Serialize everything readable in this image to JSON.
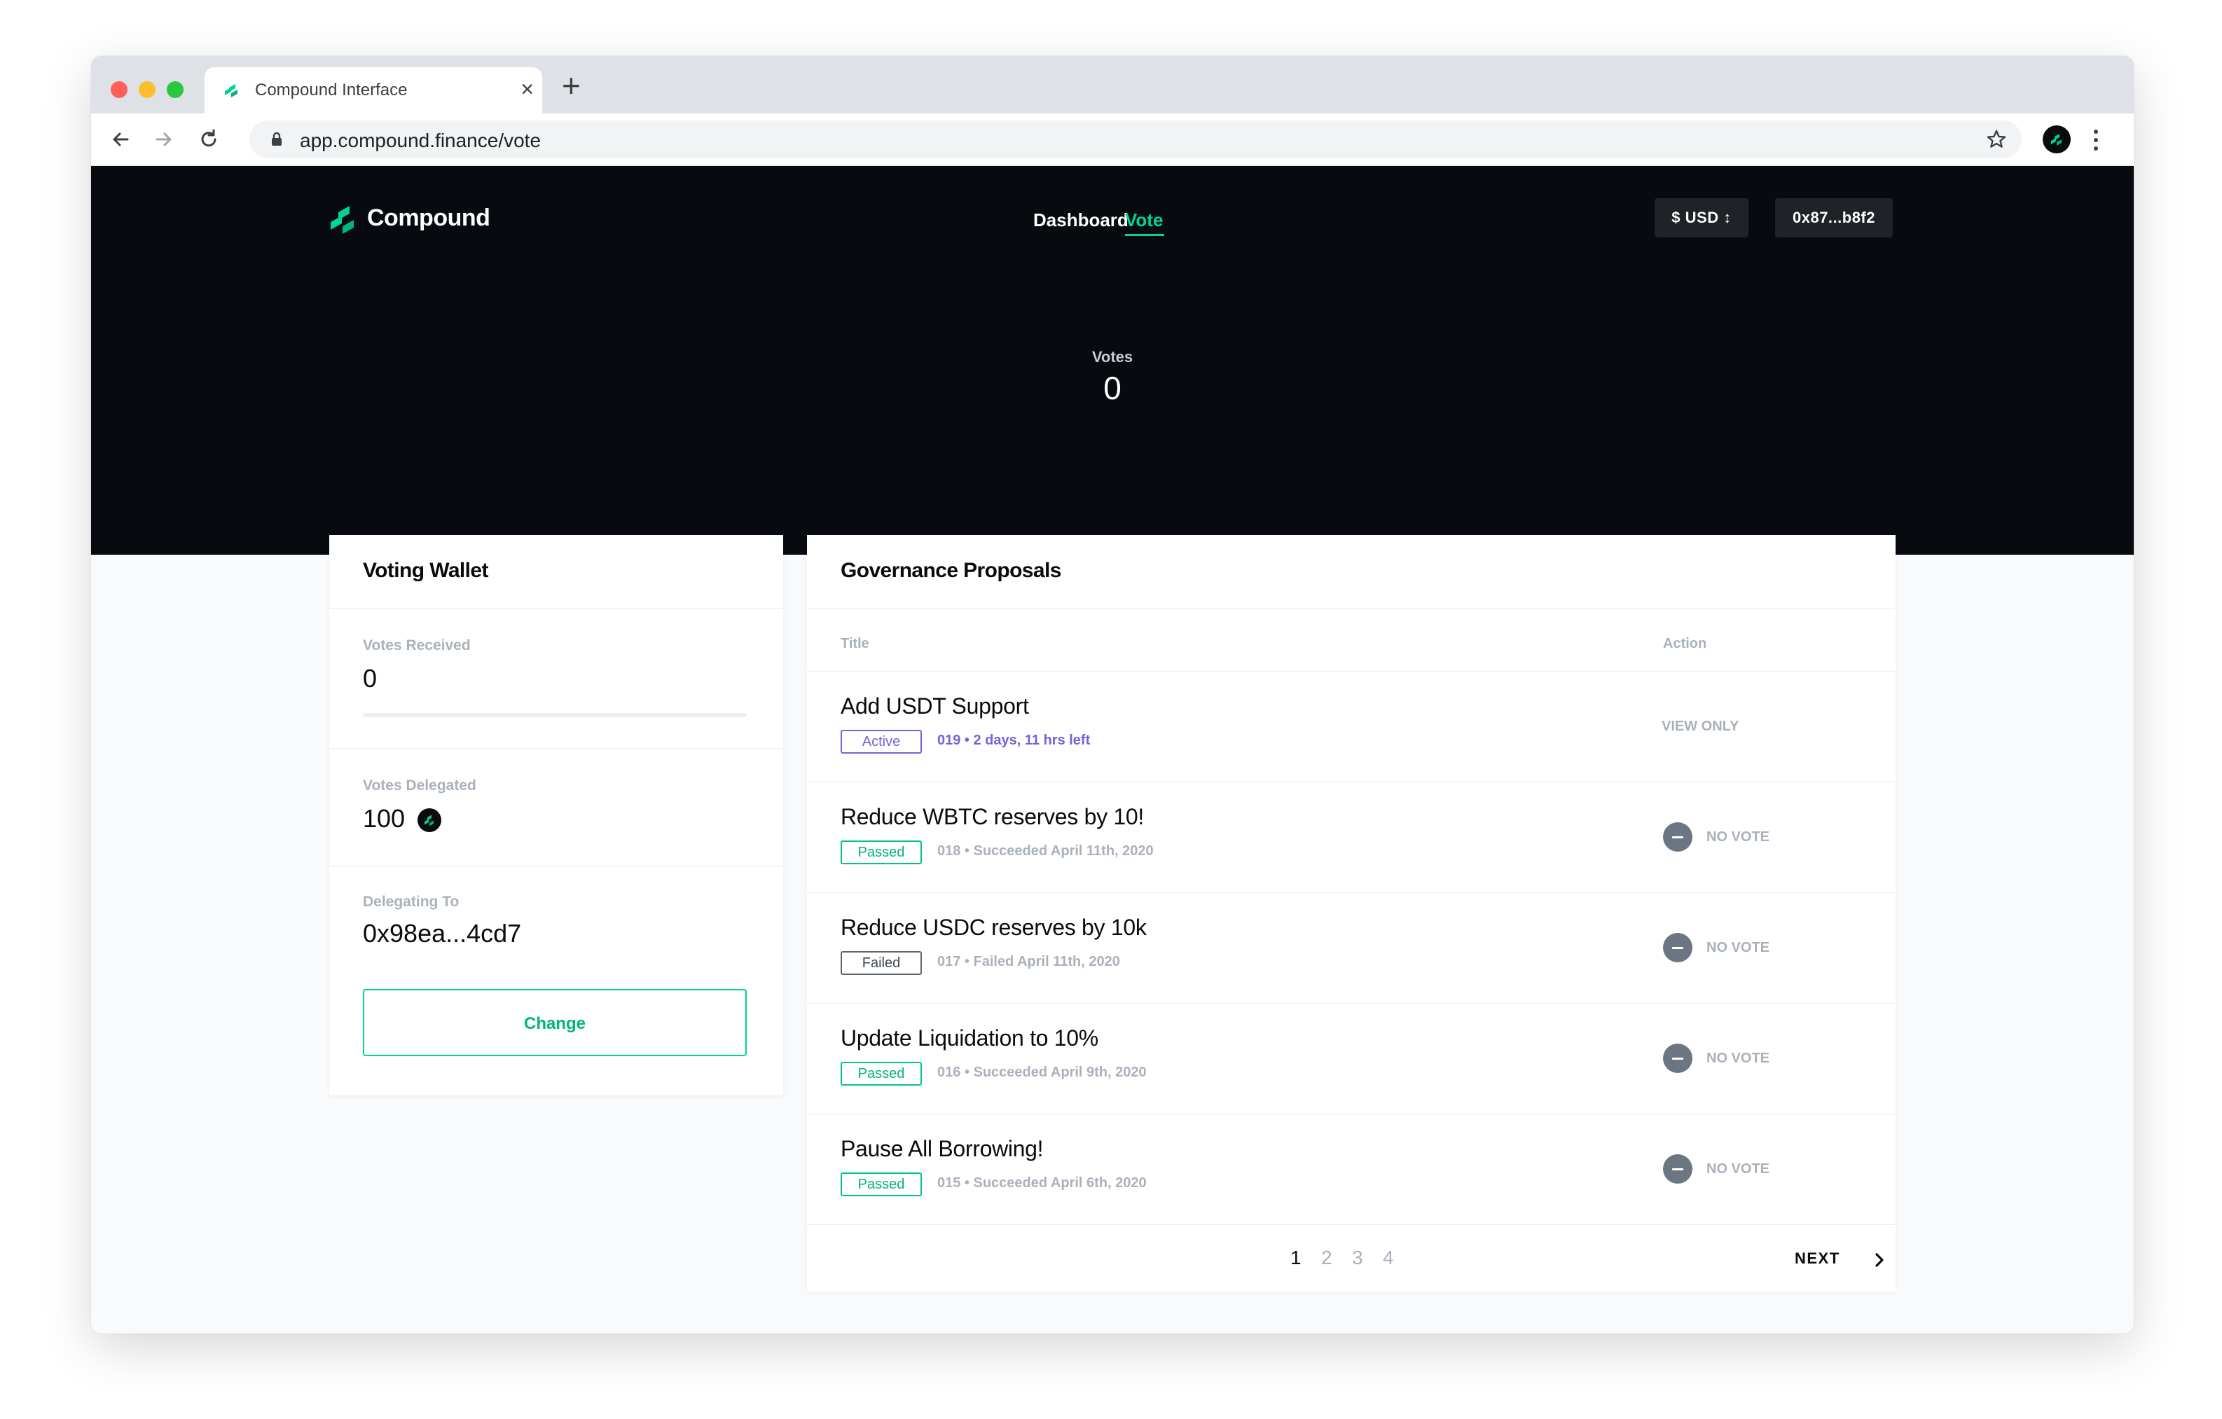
{
  "browser": {
    "tab_title": "Compound Interface",
    "new_tab_glyph": "+",
    "close_tab_glyph": "×",
    "url": "app.compound.finance/vote"
  },
  "header": {
    "brand": "Compound",
    "nav": {
      "dashboard": "Dashboard",
      "vote": "Vote"
    },
    "currency": "$ USD ↕",
    "account": "0x87...b8f2"
  },
  "hero": {
    "label": "Votes",
    "value": "0"
  },
  "wallet": {
    "title": "Voting Wallet",
    "votes_received_label": "Votes Received",
    "votes_received_value": "0",
    "votes_received_progress": 0,
    "votes_delegated_label": "Votes Delegated",
    "votes_delegated_value": "100",
    "delegating_to_label": "Delegating To",
    "delegating_to_value": "0x98ea...4cd7",
    "change_button": "Change"
  },
  "proposals": {
    "title": "Governance Proposals",
    "col_title": "Title",
    "col_action": "Action",
    "rows": [
      {
        "title": "Add USDT Support",
        "status": "Active",
        "meta": "019 • 2 days, 11 hrs left",
        "action": "VIEW ONLY"
      },
      {
        "title": "Reduce WBTC reserves by 10!",
        "status": "Passed",
        "meta": "018 • Succeeded April 11th, 2020",
        "action": "NO VOTE"
      },
      {
        "title": "Reduce USDC reserves by 10k",
        "status": "Failed",
        "meta": "017 • Failed April 11th, 2020",
        "action": "NO VOTE"
      },
      {
        "title": "Update Liquidation to 10%",
        "status": "Passed",
        "meta": "016 • Succeeded April 9th, 2020",
        "action": "NO VOTE"
      },
      {
        "title": "Pause All Borrowing!",
        "status": "Passed",
        "meta": "015 • Succeeded April 6th, 2020",
        "action": "NO VOTE"
      }
    ],
    "pages": [
      "1",
      "2",
      "3",
      "4"
    ],
    "current_page": "1",
    "next_label": "NEXT"
  },
  "colors": {
    "brand_green": "#00d395",
    "hero_bg": "#070a0e",
    "active_purple": "#7b61d6",
    "failed_gray": "#5f6872"
  },
  "icons": [
    "back-icon",
    "forward-icon",
    "reload-icon",
    "lock-icon",
    "star-icon",
    "profile-icon",
    "more-icon",
    "compound-logo",
    "comp-token-icon",
    "no-vote-icon",
    "chevron-right-icon"
  ]
}
